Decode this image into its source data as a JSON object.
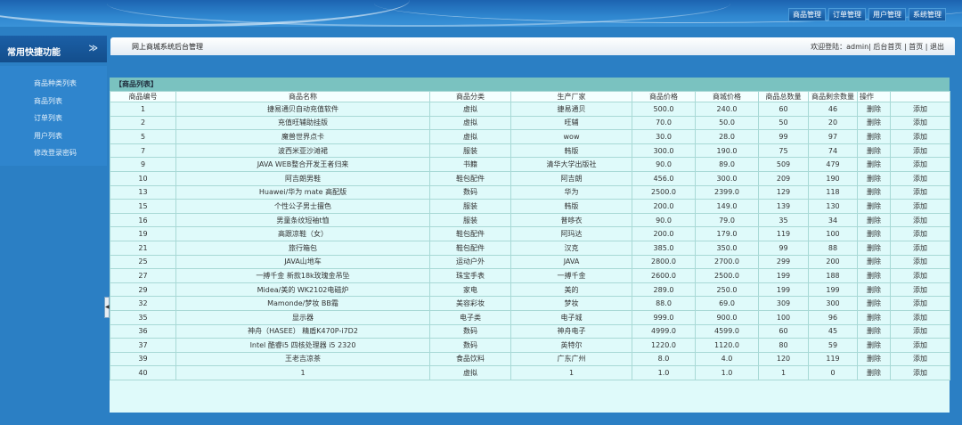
{
  "topnav": [
    "商品管理",
    "订单管理",
    "用户管理",
    "系统管理"
  ],
  "sidebar": {
    "title": "常用快捷功能",
    "chev": "≫",
    "items": [
      "商品种类列表",
      "商品列表",
      "订单列表",
      "用户列表",
      "修改登录密码"
    ]
  },
  "header": {
    "title": "网上商城系统后台管理",
    "welcome": "欢迎登陆：admin|",
    "links": [
      "后台首页",
      "首页",
      "退出"
    ],
    "sep": "|"
  },
  "panel": {
    "title": "【商品列表】",
    "columns": [
      "商品编号",
      "商品名称",
      "商品分类",
      "生产厂家",
      "商品价格",
      "商城价格",
      "商品总数量",
      "商品剩余数量",
      "操作",
      ""
    ]
  },
  "rows": [
    [
      "1",
      "捷易通贝自动充值软件",
      "虚拟",
      "捷易通贝",
      "500.0",
      "240.0",
      "60",
      "46",
      "删除",
      "添加"
    ],
    [
      "2",
      "充值旺辅助挂版",
      "虚拟",
      "旺辅",
      "70.0",
      "50.0",
      "50",
      "20",
      "删除",
      "添加"
    ],
    [
      "5",
      "魔兽世界点卡",
      "虚拟",
      "wow",
      "30.0",
      "28.0",
      "99",
      "97",
      "删除",
      "添加"
    ],
    [
      "7",
      "波西米亚沙滩裙",
      "服装",
      "韩版",
      "300.0",
      "190.0",
      "75",
      "74",
      "删除",
      "添加"
    ],
    [
      "9",
      "JAVA WEB整合开发王者归来",
      "书籍",
      "清华大学出版社",
      "90.0",
      "89.0",
      "509",
      "479",
      "删除",
      "添加"
    ],
    [
      "10",
      "阿吉朗男鞋",
      "鞋包配件",
      "阿吉朗",
      "456.0",
      "300.0",
      "209",
      "190",
      "删除",
      "添加"
    ],
    [
      "13",
      "Huawei/华为 mate 高配版",
      "数码",
      "华为",
      "2500.0",
      "2399.0",
      "129",
      "118",
      "删除",
      "添加"
    ],
    [
      "15",
      "个性公子男士擅色",
      "服装",
      "韩版",
      "200.0",
      "149.0",
      "139",
      "130",
      "删除",
      "添加"
    ],
    [
      "16",
      "男童条纹短袖t恤",
      "服装",
      "普哆衣",
      "90.0",
      "79.0",
      "35",
      "34",
      "删除",
      "添加"
    ],
    [
      "19",
      "高跟凉鞋（女）",
      "鞋包配件",
      "阿玛达",
      "200.0",
      "179.0",
      "119",
      "100",
      "删除",
      "添加"
    ],
    [
      "21",
      "旅行箱包",
      "鞋包配件",
      "汉克",
      "385.0",
      "350.0",
      "99",
      "88",
      "删除",
      "添加"
    ],
    [
      "25",
      "JAVA山地车",
      "运动户外",
      "JAVA",
      "2800.0",
      "2700.0",
      "299",
      "200",
      "删除",
      "添加"
    ],
    [
      "27",
      "一搏千金 新款18k玫瑰金吊坠",
      "珠宝手表",
      "一搏千金",
      "2600.0",
      "2500.0",
      "199",
      "188",
      "删除",
      "添加"
    ],
    [
      "29",
      "Midea/美的 WK2102电磁炉",
      "家电",
      "美的",
      "289.0",
      "250.0",
      "199",
      "199",
      "删除",
      "添加"
    ],
    [
      "32",
      "Mamonde/梦妆 BB霜",
      "美容彩妆",
      "梦妆",
      "88.0",
      "69.0",
      "309",
      "300",
      "删除",
      "添加"
    ],
    [
      "35",
      "显示器",
      "电子类",
      "电子城",
      "999.0",
      "900.0",
      "100",
      "96",
      "删除",
      "添加"
    ],
    [
      "36",
      "神舟（HASEE） 精盾K470P-i7D2",
      "数码",
      "神舟电子",
      "4999.0",
      "4599.0",
      "60",
      "45",
      "删除",
      "添加"
    ],
    [
      "37",
      "Intel 酷睿i5 四核处理器 i5 2320",
      "数码",
      "英特尔",
      "1220.0",
      "1120.0",
      "80",
      "59",
      "删除",
      "添加"
    ],
    [
      "39",
      "王老吉凉茶",
      "食品饮料",
      "广东广州",
      "8.0",
      "4.0",
      "120",
      "119",
      "删除",
      "添加"
    ],
    [
      "40",
      "1",
      "虚拟",
      "1",
      "1.0",
      "1.0",
      "1",
      "0",
      "删除",
      "添加"
    ]
  ]
}
